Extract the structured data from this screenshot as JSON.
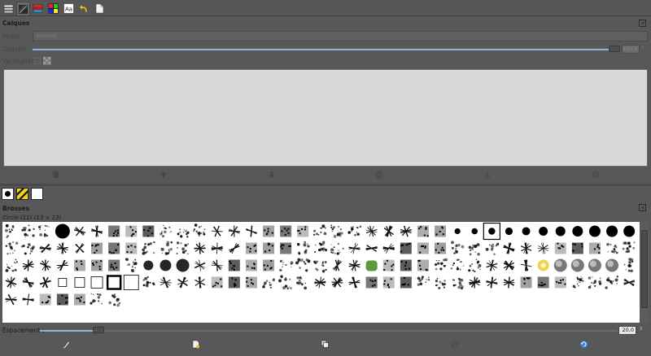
{
  "tabs": [
    {
      "name": "layers-tab-icon",
      "active": false
    },
    {
      "name": "channels-tab-icon",
      "active": true
    },
    {
      "name": "paths-tab-icon",
      "active": false
    },
    {
      "name": "colormap-tab-icon",
      "active": false
    },
    {
      "name": "fonts-tab-icon",
      "label": "Aa",
      "active": false
    },
    {
      "name": "undo-history-tab-icon",
      "active": false
    },
    {
      "name": "document-tab-icon",
      "active": false
    }
  ],
  "layers": {
    "title": "Calques",
    "mode_label": "Mode :",
    "mode_value": "Normal",
    "opacity_label": "Opacité :",
    "opacity_value": "100,0",
    "lock_label": "Verrouiller :",
    "buttons": [
      "new-layer-icon",
      "raise-layer-icon",
      "lower-layer-icon",
      "duplicate-layer-icon",
      "anchor-layer-icon",
      "delete-layer-icon"
    ]
  },
  "swatches": [
    {
      "name": "brush-preview-swatch",
      "color": "#ffffff"
    },
    {
      "name": "pattern-preview-swatch",
      "color": "#f2d21a"
    },
    {
      "name": "gradient-preview-swatch",
      "color": "#ffffff"
    }
  ],
  "brushes": {
    "title": "Brosses",
    "current": "Circle (11) (13 × 13)",
    "spacing_label": "Espacement :",
    "spacing_value": "20,0",
    "buttons": [
      "edit-brush-icon",
      "new-brush-icon",
      "duplicate-brush-icon",
      "delete-brush-icon",
      "refresh-brushes-icon"
    ]
  },
  "colors": {
    "accent": "#8fb4e0",
    "panel": "#585858",
    "list_bg": "#d8d8d8"
  }
}
